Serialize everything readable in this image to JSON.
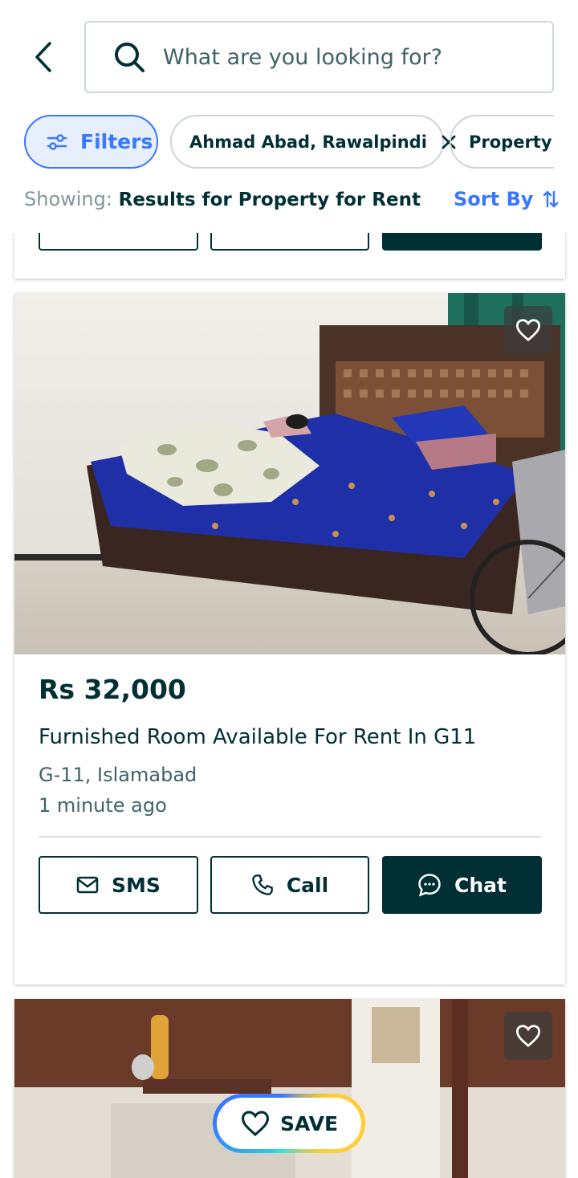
{
  "search": {
    "placeholder": "What are you looking for?"
  },
  "chips": {
    "filters_label": "Filters",
    "location_label": "Ahmad Abad, Rawalpindi",
    "category_label": "Property for Rent"
  },
  "results": {
    "showing_prefix": "Showing:",
    "showing_text": "Results for Property for Rent",
    "sort_label": "Sort By"
  },
  "listing": {
    "price": "Rs 32,000",
    "title": "Furnished Room Available For Rent In G11",
    "location": "G-11, Islamabad",
    "time": "1 minute ago",
    "sms_label": "SMS",
    "call_label": "Call",
    "chat_label": "Chat"
  },
  "save_button": {
    "label": "SAVE"
  },
  "colors": {
    "brand_dark": "#002f34",
    "accent_blue": "#3a77ff",
    "muted_text": "#406367"
  }
}
